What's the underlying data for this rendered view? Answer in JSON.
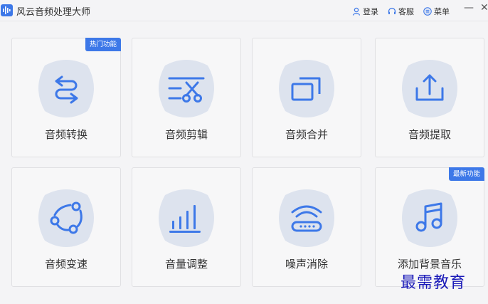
{
  "app": {
    "title": "风云音频处理大师"
  },
  "header": {
    "login_label": "登录",
    "service_label": "客服",
    "menu_label": "菜单",
    "minimize_glyph": "—",
    "close_glyph": "✕"
  },
  "colors": {
    "accent": "#3d78e8",
    "icon_bg": "#dde3ee",
    "badge": "#3d78e8"
  },
  "cards": [
    {
      "label": "音频转换",
      "icon": "convert-icon",
      "badge": "热门功能"
    },
    {
      "label": "音频剪辑",
      "icon": "scissors-icon",
      "badge": ""
    },
    {
      "label": "音频合并",
      "icon": "merge-icon",
      "badge": ""
    },
    {
      "label": "音频提取",
      "icon": "extract-icon",
      "badge": ""
    },
    {
      "label": "音频变速",
      "icon": "speed-icon",
      "badge": ""
    },
    {
      "label": "音量调整",
      "icon": "volume-bars-icon",
      "badge": ""
    },
    {
      "label": "噪声消除",
      "icon": "noise-icon",
      "badge": ""
    },
    {
      "label": "添加背景音乐",
      "icon": "music-note-icon",
      "badge": "最新功能"
    }
  ],
  "watermark": "最需教育"
}
